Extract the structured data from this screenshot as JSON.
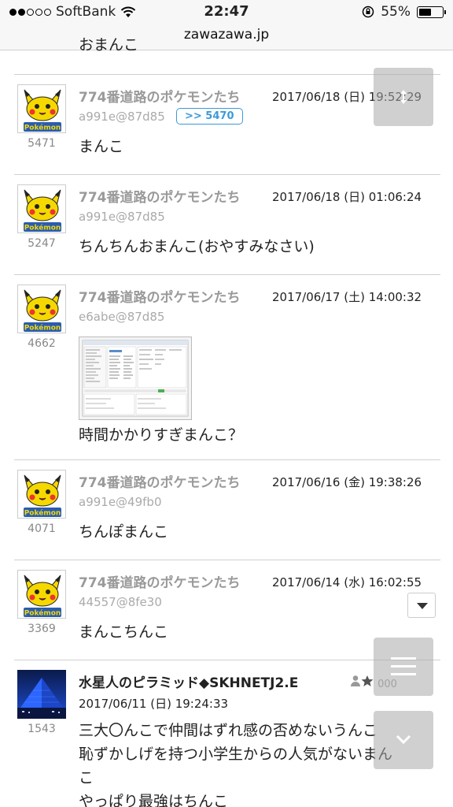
{
  "status": {
    "carrier": "SoftBank",
    "time": "22:47",
    "battery": "55%",
    "battery_level": 0.55,
    "url": "zawazawa.jp"
  },
  "feed": {
    "clipped_text": "おまんこ",
    "posts": [
      {
        "name": "774番道路のポケモンたち",
        "date": "2017/06/18 (日) 19:52:29",
        "id": "a991e@87d85",
        "number": "5471",
        "reply": ">> 5470",
        "body": "まんこ",
        "avatar": "pikachu-pokemon-avatar"
      },
      {
        "name": "774番道路のポケモンたち",
        "date": "2017/06/18 (日) 01:06:24",
        "id": "a991e@87d85",
        "number": "5247",
        "body": "ちんちんおまんこ(おやすみなさい)",
        "avatar": "pikachu-pokemon-avatar"
      },
      {
        "name": "774番道路のポケモンたち",
        "date": "2017/06/17 (土) 14:00:32",
        "id": "e6abe@87d85",
        "number": "4662",
        "body": "時間かかりすぎまんこ？",
        "avatar": "pikachu-pokemon-avatar",
        "attachment": "screenshot-thumbnail"
      },
      {
        "name": "774番道路のポケモンたち",
        "date": "2017/06/16 (金) 19:38:26",
        "id": "a991e@49fb0",
        "number": "4071",
        "body": "ちんぽまんこ",
        "avatar": "pikachu-pokemon-avatar"
      },
      {
        "name": "774番道路のポケモンたち",
        "date": "2017/06/14 (水) 16:02:55",
        "id": "44557@8fe30",
        "number": "3369",
        "body": "まんこちんこ",
        "avatar": "pikachu-pokemon-avatar"
      },
      {
        "name": "水星人のピラミッド◆SKHNETJ2.E",
        "level": "000",
        "date": "2017/06/11 (日) 19:24:33",
        "number": "1543",
        "body_lines": [
          "三大〇んこで仲間はずれ感の否めないうんこ",
          "恥ずかしげを持つ小学生からの人気がないまん",
          "こ",
          "やっぱり最強はちんこ"
        ],
        "avatar": "blue-pyramid-avatar"
      }
    ]
  },
  "colors": {
    "name_gray": "#9a9a9a",
    "reply_blue": "#3b9ad9",
    "divider": "#cfcfcf"
  },
  "icons": {
    "scroll": "up-down-arrow-icon",
    "menu": "hamburger-menu-icon",
    "dropdown": "triangle-down-icon",
    "jump": "chevron-down-icon"
  }
}
